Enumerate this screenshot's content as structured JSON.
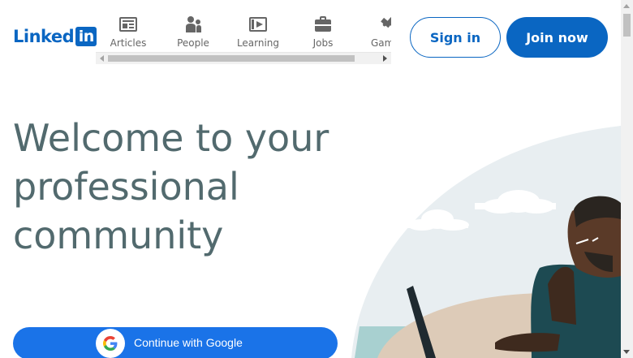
{
  "header": {
    "logo": "LinkedIn",
    "logo_word": "Linked",
    "logo_box": "in",
    "nav": [
      {
        "label": "Articles",
        "icon": "articles-icon"
      },
      {
        "label": "People",
        "icon": "people-icon"
      },
      {
        "label": "Learning",
        "icon": "learning-icon"
      },
      {
        "label": "Jobs",
        "icon": "jobs-icon"
      },
      {
        "label": "Games",
        "icon": "games-icon"
      }
    ],
    "sign_in": "Sign in",
    "join_now": "Join now"
  },
  "hero": {
    "headline": "Welcome to your professional community",
    "google_button": "Continue with Google"
  },
  "colors": {
    "brand": "#0a66c2",
    "headline": "#526a6e",
    "google_blue": "#1a73e8"
  }
}
